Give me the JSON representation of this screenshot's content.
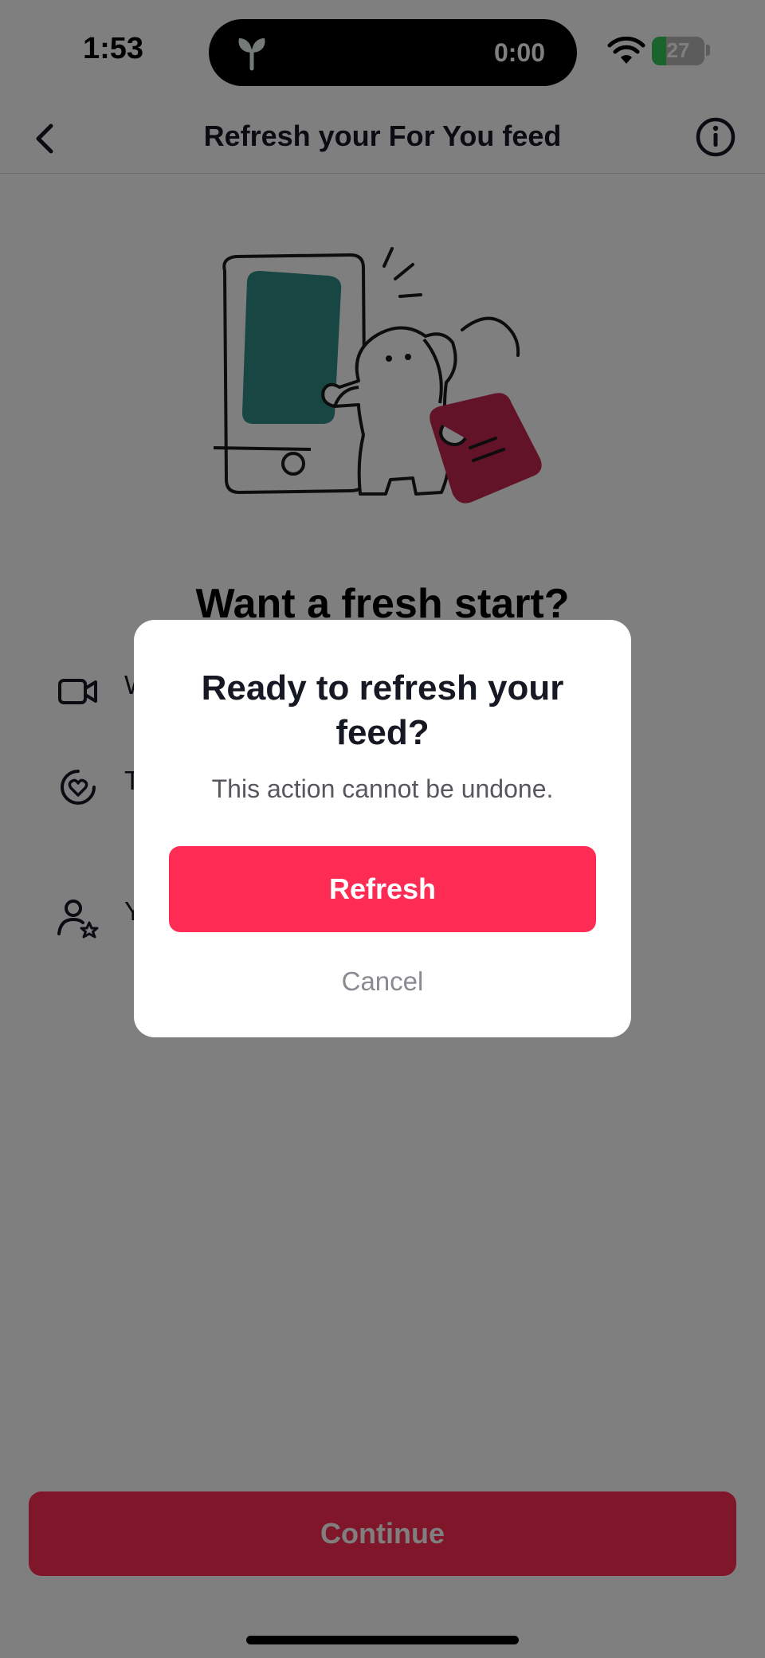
{
  "status_bar": {
    "time": "1:53",
    "timer": "0:00",
    "battery_level": "27",
    "battery_fraction": 0.27,
    "icons": [
      "leaf-icon",
      "wifi-icon",
      "battery-charging-icon"
    ]
  },
  "header": {
    "title": "Refresh your For You feed",
    "back_icon": "chevron-left-icon",
    "info_icon": "info-circle-icon"
  },
  "page": {
    "heading": "Want a fresh start?",
    "features": [
      {
        "icon": "video-camera-icon",
        "text": "W… …your m…"
      },
      {
        "icon": "heart-circle-icon",
        "text": "T… …ized y… r…"
      },
      {
        "icon": "user-star-icon",
        "text": "Y… …on’t b…"
      }
    ],
    "continue_label": "Continue"
  },
  "dialog": {
    "title": "Ready to refresh your feed?",
    "message": "This action cannot be undone.",
    "refresh_label": "Refresh",
    "cancel_label": "Cancel"
  },
  "colors": {
    "accent": "#fe2c55",
    "illustration_teal": "#2e8c87",
    "illustration_red": "#c6274e",
    "overlay": "rgba(0,0,0,0.5)"
  }
}
